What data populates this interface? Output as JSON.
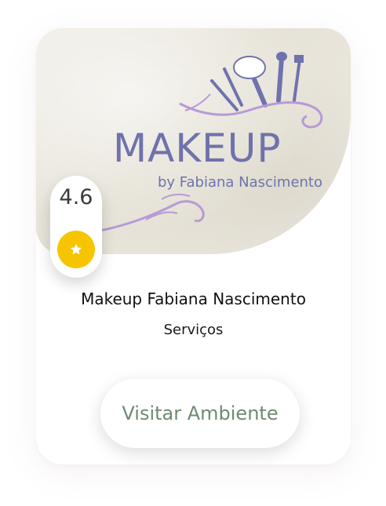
{
  "card": {
    "banner": {
      "logo_title": "MAKEUP",
      "logo_subtitle": "by Fabiana Nascimento"
    },
    "rating": {
      "value": "4.6",
      "icon": "star-icon"
    },
    "title": "Makeup Fabiana Nascimento",
    "category": "Serviços",
    "visit_button_label": "Visitar Ambiente"
  },
  "colors": {
    "logo": "#6f72ad",
    "flourish": "#b79ad6",
    "star_badge": "#f7c400",
    "button_text": "#6e8a72"
  }
}
